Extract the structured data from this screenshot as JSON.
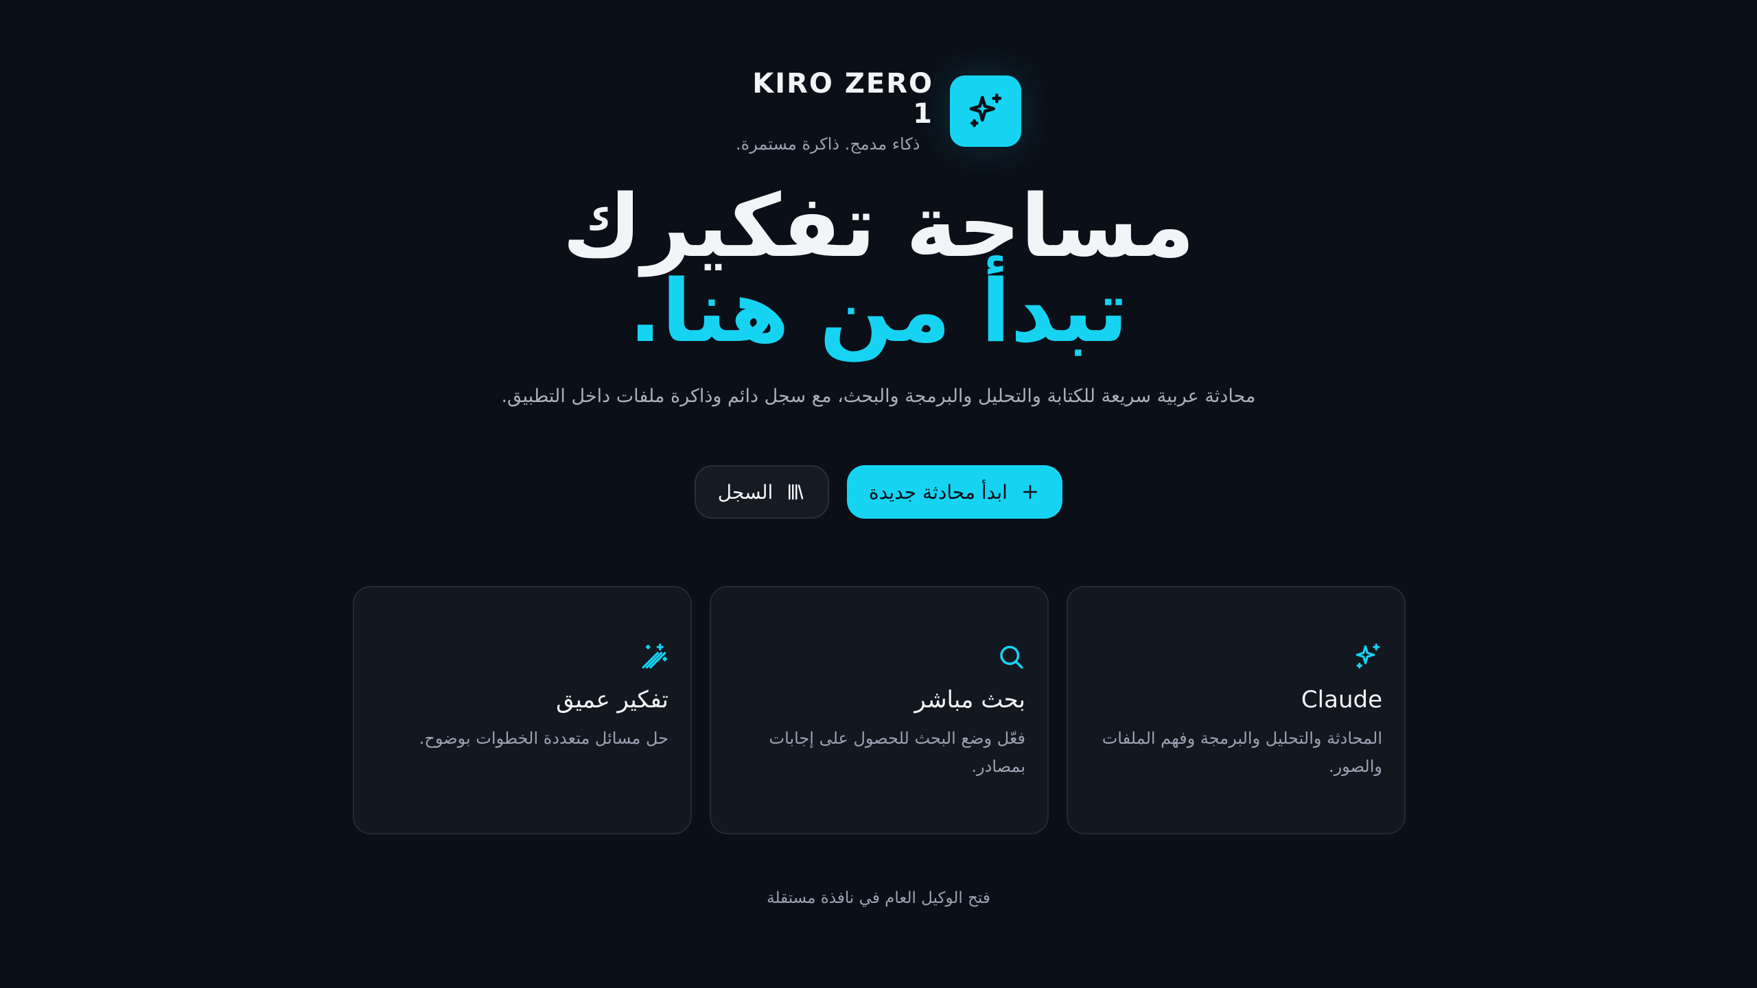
{
  "brand": {
    "name": "KIRO ZERO 1",
    "tagline": "ذكاء مدمج. ذاكرة مستمرة.",
    "logo_icon": "sparkles-icon",
    "accent_color": "#16d3f2"
  },
  "hero": {
    "line1": "مساحة تفكيرك",
    "line2": "تبدأ من هنا."
  },
  "subtitle": "محادثة عربية سريعة للكتابة والتحليل والبرمجة والبحث، مع سجل دائم وذاكرة ملفات داخل التطبيق.",
  "actions": {
    "new_chat": {
      "label": "ابدأ محادثة جديدة",
      "icon": "plus-icon"
    },
    "history": {
      "label": "السجل",
      "icon": "library-icon"
    }
  },
  "cards": [
    {
      "title": "Claude",
      "description": "المحادثة والتحليل والبرمجة وفهم الملفات والصور.",
      "icon": "sparkles-icon"
    },
    {
      "title": "بحث مباشر",
      "description": "فعّل وضع البحث للحصول على إجابات بمصادر.",
      "icon": "search-icon"
    },
    {
      "title": "تفكير عميق",
      "description": "حل مسائل متعددة الخطوات بوضوح.",
      "icon": "magic-wand-icon"
    }
  ],
  "footer": {
    "link": "فتح الوكيل العام في نافذة مستقلة"
  }
}
